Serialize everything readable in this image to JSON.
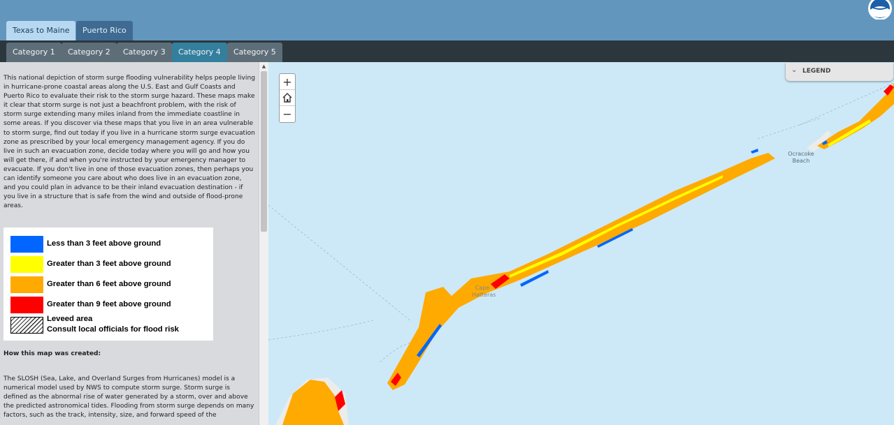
{
  "header": {
    "region_tabs": [
      {
        "label": "Texas to Maine",
        "active": true
      },
      {
        "label": "Puerto Rico",
        "active": false
      }
    ],
    "logo": "noaa-logo-icon"
  },
  "category_tabs": [
    {
      "label": "Category 1",
      "active": false
    },
    {
      "label": "Category 2",
      "active": false
    },
    {
      "label": "Category 3",
      "active": false
    },
    {
      "label": "Category 4",
      "active": true
    },
    {
      "label": "Category 5",
      "active": false
    }
  ],
  "sidebar": {
    "intro": "This national depiction of storm surge flooding vulnerability helps people living in hurricane-prone coastal areas along the U.S. East and Gulf Coasts and Puerto Rico to evaluate their risk to the storm surge hazard. These maps make it clear that storm surge is not just a beachfront problem, with the risk of storm surge extending many miles inland from the immediate coastline in some areas. If you discover via these maps that you live in an area vulnerable to storm surge, find out today if you live in a hurricane storm surge evacuation zone as prescribed by your local emergency management agency. If you do live in such an evacuation zone, decide today where you will go and how you will get there, if and when you're instructed by your emergency manager to evacuate. If you don't live in one of those evacuation zones, then perhaps you can identify someone you care about who does live in an evacuation zone, and you could plan in advance to be their inland evacuation destination - if you live in a structure that is safe from the wind and outside of flood-prone areas.",
    "legend": [
      {
        "label": "Less than 3 feet above ground",
        "color": "#0066ff"
      },
      {
        "label": "Greater than 3 feet above ground",
        "color": "#ffff00"
      },
      {
        "label": "Greater than 6 feet above ground",
        "color": "#ffaa00"
      },
      {
        "label": "Greater than 9 feet above ground",
        "color": "#ff0000"
      }
    ],
    "levee_line1": "Leveed area",
    "levee_line2": "Consult local officials for flood risk",
    "how_heading": "How this map was created:",
    "slosh_text": "The SLOSH (Sea, Lake, and Overland Surges from Hurricanes) model is a numerical model used by NWS to compute storm surge. Storm surge is defined as the abnormal rise of water generated by a storm, over and above the predicted astronomical tides. Flooding from storm surge depends on many factors, such as the track, intensity, size, and forward speed of the"
  },
  "map": {
    "zoom_in": "+",
    "home_icon": "home-icon",
    "zoom_out": "−",
    "legend_toggle": "LEGEND",
    "labels": {
      "ocracoke_line1": "Ocracoke",
      "ocracoke_line2": "Beach",
      "cape_line1": "Cape",
      "cape_line2": "Hatteras"
    },
    "colors": {
      "water": "#cde9f8",
      "surge_orange": "#ffaa00",
      "surge_yellow": "#ffff00",
      "surge_red": "#ff0000",
      "surge_blue": "#0066ff"
    }
  }
}
